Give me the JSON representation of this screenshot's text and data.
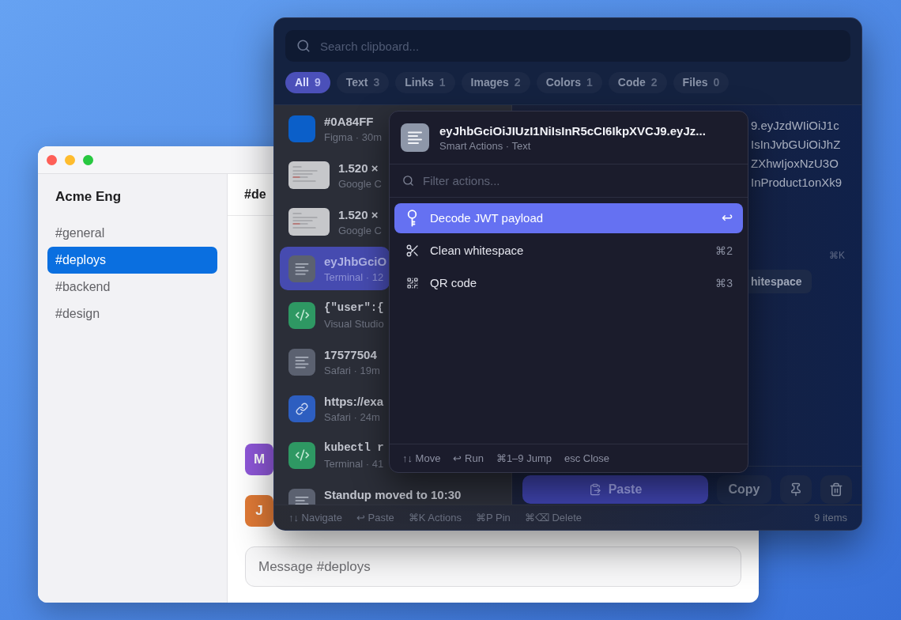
{
  "chat": {
    "workspace": "Acme Eng",
    "channels": [
      {
        "name": "#general",
        "selected": false
      },
      {
        "name": "#deploys",
        "selected": true
      },
      {
        "name": "#backend",
        "selected": false
      },
      {
        "name": "#design",
        "selected": false
      }
    ],
    "header": "#de",
    "avatars": [
      {
        "initial": "M",
        "color": "#8e57d8"
      },
      {
        "initial": "J",
        "color": "#e07a36"
      }
    ],
    "composer": {
      "placeholder": "Message #deploys"
    }
  },
  "clipboard": {
    "search": {
      "placeholder": "Search clipboard..."
    },
    "filters": [
      {
        "label": "All",
        "count": "9",
        "selected": true
      },
      {
        "label": "Text",
        "count": "3",
        "selected": false
      },
      {
        "label": "Links",
        "count": "1",
        "selected": false
      },
      {
        "label": "Images",
        "count": "2",
        "selected": false
      },
      {
        "label": "Colors",
        "count": "1",
        "selected": false
      },
      {
        "label": "Code",
        "count": "2",
        "selected": false
      },
      {
        "label": "Files",
        "count": "0",
        "selected": false
      }
    ],
    "items": [
      {
        "kind": "color",
        "title": "#0A84FF",
        "source": "Figma · 30m",
        "color": "#0b5fc9",
        "selected": false
      },
      {
        "kind": "image",
        "title": "1.520 ×",
        "source": "Google C",
        "selected": false
      },
      {
        "kind": "image",
        "title": "1.520 ×",
        "source": "Google C",
        "selected": false
      },
      {
        "kind": "text",
        "title": "eyJhbGciO",
        "source": "Terminal · 12",
        "selected": true
      },
      {
        "kind": "code",
        "title": "{\"user\":{",
        "source": "Visual Studio",
        "selected": false
      },
      {
        "kind": "text",
        "title": "17577504",
        "source": "Safari · 19m",
        "selected": false
      },
      {
        "kind": "link",
        "title": "https://exa",
        "source": "Safari · 24m",
        "selected": false
      },
      {
        "kind": "code",
        "title": "kubectl r",
        "source": "Terminal · 41",
        "selected": false
      },
      {
        "kind": "text",
        "title": "Standup moved to 10:30",
        "selected": false
      }
    ],
    "preview_lines": [
      "9.eyJzdWIiOiJ1c",
      "IsInJvbGUiOiJhZ",
      "ZXhwIjoxNzU3O",
      "InProduct1onXk9"
    ],
    "actions_shortcut": "⌘K",
    "action_chip": "hitespace",
    "buttons": [
      {
        "kind": "paste",
        "label": "Paste"
      },
      {
        "kind": "copy",
        "label": "Copy"
      },
      {
        "kind": "pin"
      },
      {
        "kind": "delete"
      }
    ],
    "hints": [
      "↑↓ Navigate",
      "↩ Paste",
      "⌘K Actions",
      "⌘P Pin",
      "⌘⌫ Delete"
    ],
    "count": "9 items"
  },
  "popup": {
    "title": "eyJhbGciOiJIUzI1NiIsInR5cCI6IkpXVCJ9.eyJz...",
    "subtitle": "Smart Actions · Text",
    "filter": {
      "placeholder": "Filter actions..."
    },
    "actions": [
      {
        "kind": "decode",
        "label": "Decode JWT payload",
        "shortcut": "↩",
        "selected": true
      },
      {
        "kind": "clean",
        "label": "Clean whitespace",
        "shortcut": "⌘2",
        "selected": false
      },
      {
        "kind": "qrcode",
        "label": "QR code",
        "shortcut": "⌘3",
        "selected": false
      }
    ],
    "hints": [
      "↑↓ Move",
      "↩ Run",
      "⌘1–9 Jump",
      "esc Close"
    ]
  }
}
